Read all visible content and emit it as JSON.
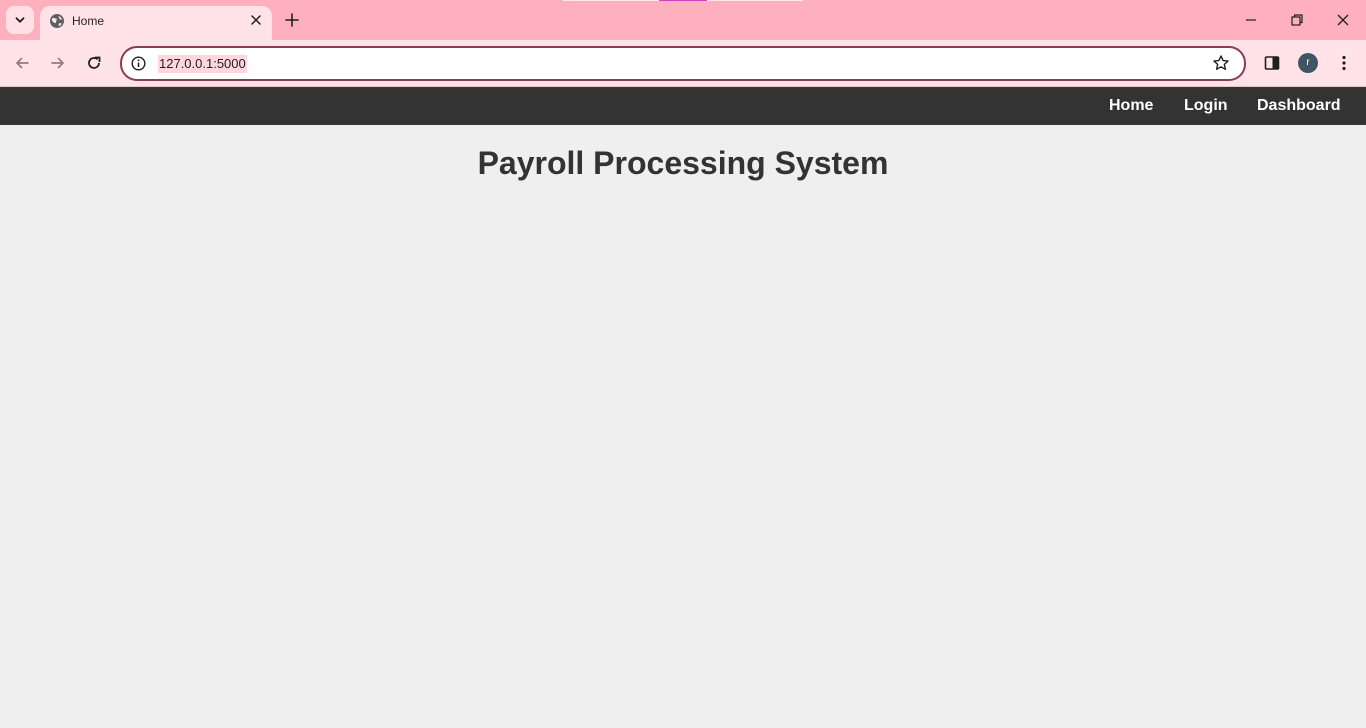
{
  "browser": {
    "tab": {
      "title": "Home"
    },
    "address_bar": {
      "url": "127.0.0.1:5000"
    },
    "profile_initial": "r"
  },
  "navbar": {
    "links": [
      "Home",
      "Login",
      "Dashboard"
    ]
  },
  "page": {
    "title": "Payroll Processing System"
  },
  "colors": {
    "tabstrip": "#ffb0be",
    "toolbar": "#ffe3e8",
    "navbar": "#333333",
    "page_background": "#efefef",
    "title_text": "#333333"
  }
}
